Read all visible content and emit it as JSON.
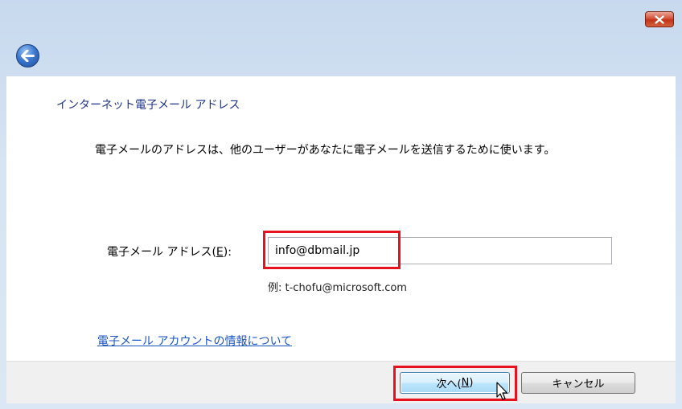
{
  "window": {
    "close_icon": "close-x-icon",
    "back_icon": "back-arrow-icon"
  },
  "page": {
    "heading": "インターネット電子メール アドレス",
    "description": "電子メールのアドレスは、他のユーザーがあなたに電子メールを送信するために使います。"
  },
  "email": {
    "label_prefix": "電子メール アドレス(",
    "label_accel": "E",
    "label_suffix": "):",
    "value": "info@dbmail.jp",
    "example": "例: t-chofu@microsoft.com"
  },
  "link": {
    "text": "電子メール アカウントの情報について"
  },
  "buttons": {
    "next_prefix": "次へ(",
    "next_accel": "N",
    "next_suffix": ")",
    "cancel": "キャンセル"
  },
  "colors": {
    "highlight": "#e8121e",
    "heading": "#1e3287",
    "link": "#1a56c2"
  }
}
